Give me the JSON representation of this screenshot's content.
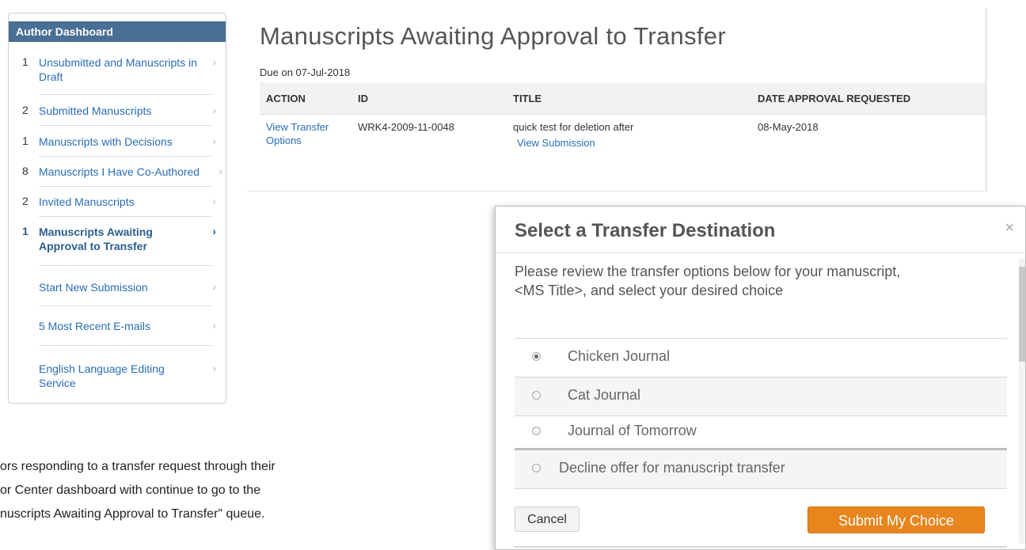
{
  "sidebar": {
    "header": "Author Dashboard",
    "items": [
      {
        "count": "1",
        "label": "Unsubmitted and Manuscripts in Draft"
      },
      {
        "count": "2",
        "label": "Submitted Manuscripts"
      },
      {
        "count": "1",
        "label": "Manuscripts with Decisions"
      },
      {
        "count": "8",
        "label": "Manuscripts I Have Co-Authored"
      },
      {
        "count": "2",
        "label": "Invited Manuscripts"
      },
      {
        "count": "1",
        "label": "Manuscripts Awaiting Approval to Transfer"
      },
      {
        "count": "",
        "label": "Start New Submission"
      },
      {
        "count": "",
        "label": "5 Most Recent E-mails"
      },
      {
        "count": "",
        "label": "English Language Editing Service"
      }
    ],
    "chevron": "›"
  },
  "main": {
    "title": "Manuscripts Awaiting Approval to Transfer",
    "due": "Due on 07-Jul-2018",
    "columns": [
      "ACTION",
      "ID",
      "TITLE",
      "DATE APPROVAL REQUESTED"
    ],
    "row": {
      "action": "View Transfer Options",
      "id": "WRK4-2009-11-0048",
      "title": "quick test for deletion after",
      "title_link": "View Submission",
      "date": "08-May-2018"
    }
  },
  "caption": [
    "ors responding to a transfer request through their",
    "or Center dashboard with continue to go to the",
    "nuscripts Awaiting Approval to Transfer\" queue."
  ],
  "modal": {
    "title": "Select a Transfer Destination",
    "close": "×",
    "intro_line1": "Please review the transfer options below for your manuscript,",
    "intro_line2": "<MS Title>, and select your desired choice",
    "options": [
      {
        "label": "Chicken Journal",
        "checked": true
      },
      {
        "label": "Cat Journal",
        "checked": false
      },
      {
        "label": "Journal of Tomorrow",
        "checked": false
      },
      {
        "label": "Decline offer for manuscript transfer",
        "checked": false
      }
    ],
    "cancel_label": "Cancel",
    "submit_label": "Submit My Choice"
  },
  "colors": {
    "sidebar_header": "#4a6f95",
    "link": "#2a6db7",
    "submit_button": "#e8851c"
  }
}
